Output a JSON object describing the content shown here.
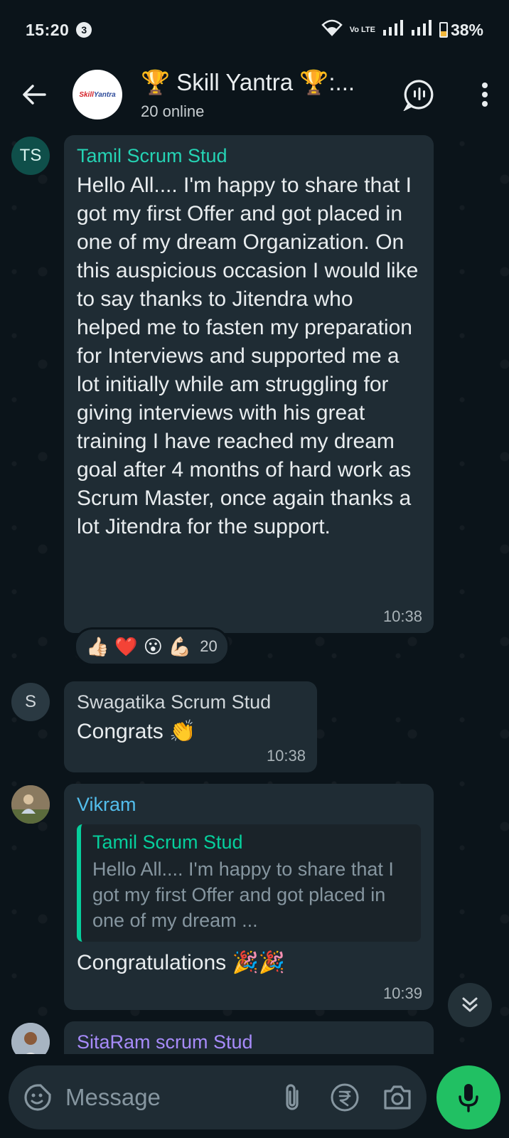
{
  "status_bar": {
    "time": "15:20",
    "notification_count": "3",
    "volte": "Vo LTE",
    "battery": "38%"
  },
  "header": {
    "group_title": "🏆 Skill Yantra 🏆:...",
    "subtitle": "20 online",
    "avatar_logo_a": "Skill",
    "avatar_logo_b": "Yantra"
  },
  "messages": [
    {
      "sender": "Tamil Scrum Stud",
      "initials": "TS",
      "sender_color": "#25d3b4",
      "avatar_bg": "#0f4f4a",
      "avatar_color": "#d7f3ee",
      "text": "Hello All.... I'm happy to share that I got my first Offer and got placed in one of my dream Organization. On this auspicious occasion I would like to say thanks  to Jitendra who helped me to fasten my preparation for Interviews and supported me a lot initially while am struggling for giving interviews with his great training I have reached my dream goal after 4 months of hard work as Scrum Master, once again thanks a lot Jitendra for the support.",
      "time": "10:38",
      "reactions": [
        "👍🏻",
        "❤️",
        "😮",
        "💪🏻"
      ],
      "reaction_count": "20"
    },
    {
      "sender": "Swagatika Scrum Stud",
      "initials": "S",
      "sender_color": "#d1d7db",
      "avatar_bg": "#2a3942",
      "avatar_color": "#d1d7db",
      "text": "Congrats 👏",
      "time": "10:38"
    },
    {
      "sender": "Vikram",
      "sender_color": "#53bdeb",
      "quote_sender": "Tamil Scrum Stud",
      "quote_text": "Hello All.... I'm happy to share that I got my first Offer and got placed in one of my dream ...",
      "text": "Congratulations 🎉🎉",
      "time": "10:39"
    },
    {
      "sender": "SitaRam scrum Stud",
      "sender_color": "#a78bfa"
    }
  ],
  "composer": {
    "placeholder": "Message"
  },
  "colors": {
    "background": "#0b141a",
    "bubble": "#1f2c34",
    "accent_green": "#21c063"
  }
}
